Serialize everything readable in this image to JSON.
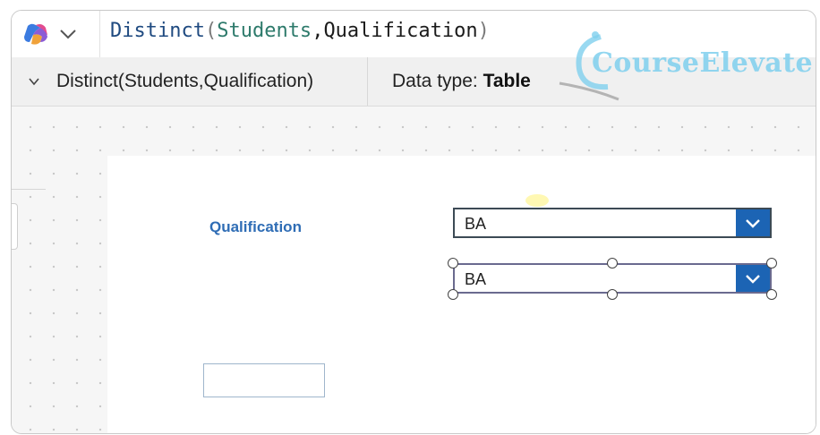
{
  "formula_bar": {
    "formula_tokens": [
      {
        "text": "Distinct",
        "kind": "func"
      },
      {
        "text": "(",
        "kind": "paren"
      },
      {
        "text": "Students",
        "kind": "green"
      },
      {
        "text": ",",
        "kind": "black"
      },
      {
        "text": "Qualification",
        "kind": "black"
      },
      {
        "text": ")",
        "kind": "paren"
      }
    ],
    "copilot_icon": "copilot-icon",
    "chevron_icon": "chevron-down-icon"
  },
  "info_bar": {
    "expression": "Distinct(Students,Qualification)",
    "datatype_label": "Data type: ",
    "datatype_value": "Table"
  },
  "watermark": {
    "text": "CourseElevate"
  },
  "canvas": {
    "qualification_label": "Qualification",
    "dropdown_1_value": "BA",
    "dropdown_2_value": "BA",
    "text_input_value": ""
  },
  "colors": {
    "accent": "#1c64b4",
    "label_blue": "#2f6db5",
    "watermark": "#7fd0ee"
  }
}
